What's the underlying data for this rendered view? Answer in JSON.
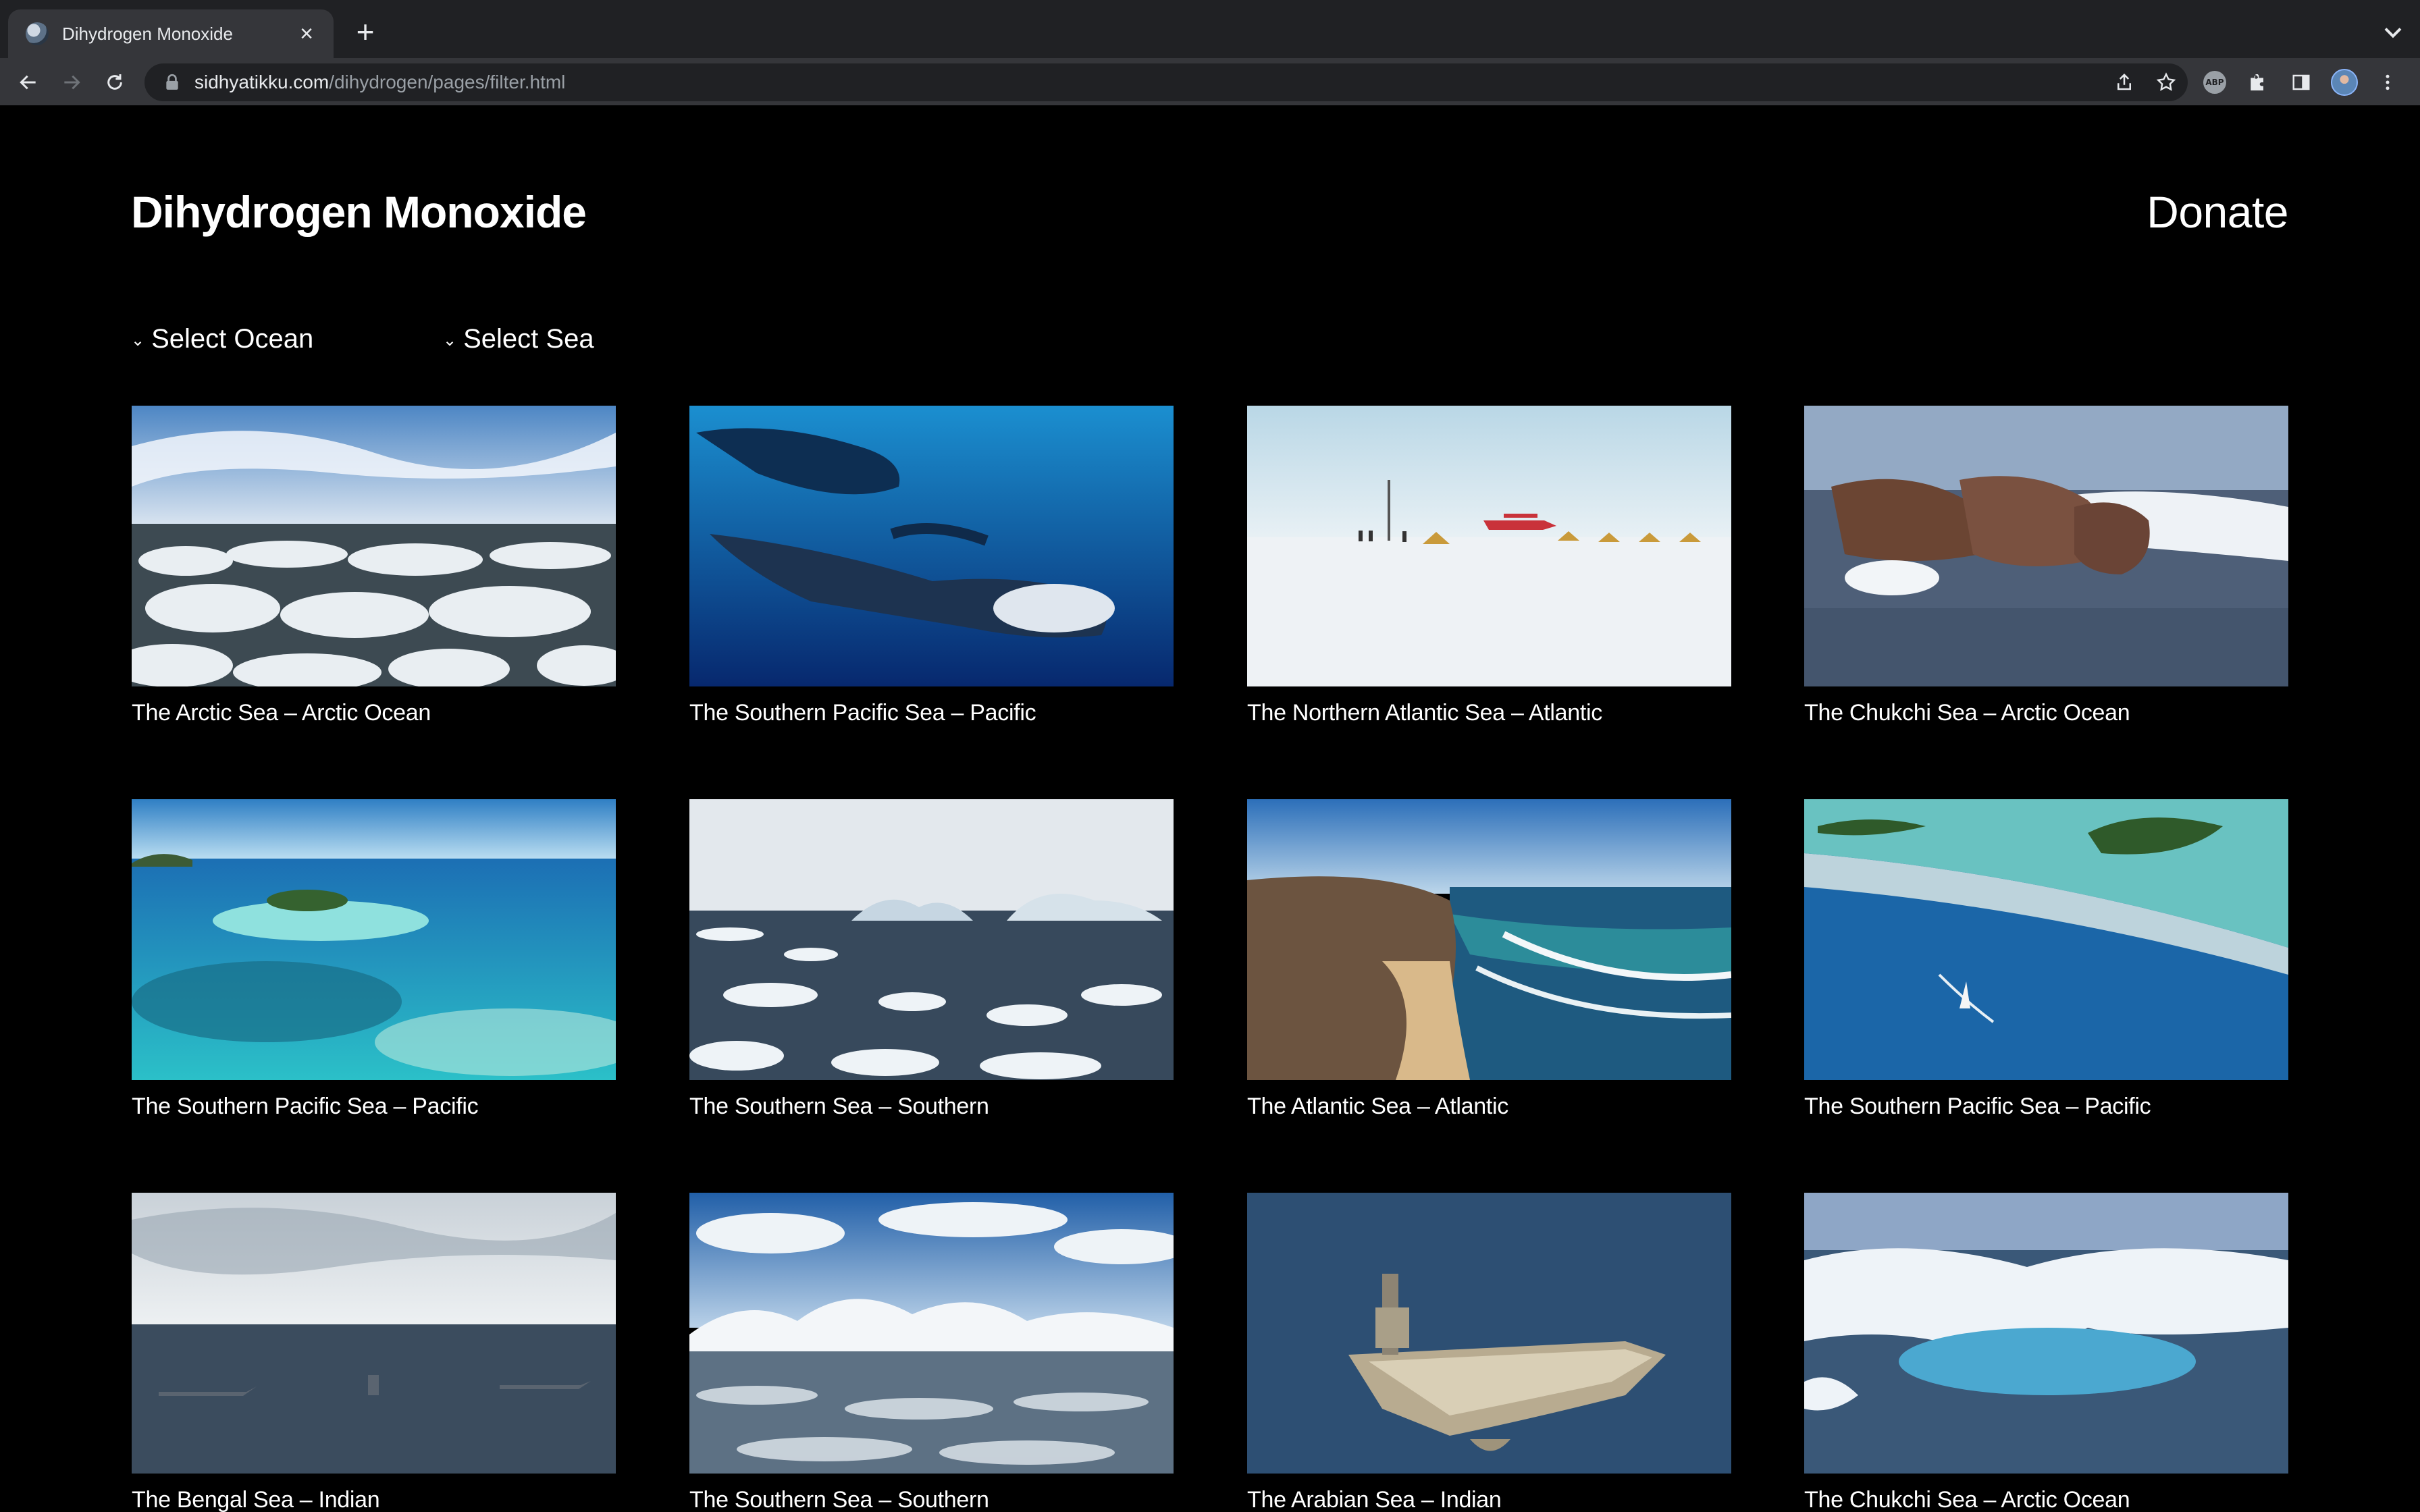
{
  "browser": {
    "tab_title": "Dihydrogen Monoxide",
    "url_host": "sidhyatikku.com",
    "url_path": "/dihydrogen/pages/filter.html",
    "extension_label": "ABP"
  },
  "header": {
    "title": "Dihydrogen Monoxide",
    "donate_label": "Donate"
  },
  "filters": {
    "ocean_label": "Select Ocean",
    "sea_label": "Select Sea"
  },
  "cards": [
    {
      "caption": "The Arctic Sea – Arctic Ocean",
      "scene": "ice-floes"
    },
    {
      "caption": "The Southern Pacific Sea – Pacific",
      "scene": "manta-rays"
    },
    {
      "caption": "The Northern Atlantic Sea – Atlantic",
      "scene": "ice-camp"
    },
    {
      "caption": "The Chukchi Sea – Arctic Ocean",
      "scene": "walruses"
    },
    {
      "caption": "The Southern Pacific Sea – Pacific",
      "scene": "tropical-lagoon"
    },
    {
      "caption": "The Southern Sea – Southern",
      "scene": "icebergs"
    },
    {
      "caption": "The Atlantic Sea – Atlantic",
      "scene": "coastal-cliffs"
    },
    {
      "caption": "The Southern Pacific Sea – Pacific",
      "scene": "reef-sailboat"
    },
    {
      "caption": "The Bengal Sea – Indian",
      "scene": "naval-fleet"
    },
    {
      "caption": "The Southern Sea – Southern",
      "scene": "antarctic-mountains"
    },
    {
      "caption": "The Arabian Sea – Indian",
      "scene": "aircraft-carrier"
    },
    {
      "caption": "The Chukchi Sea – Arctic Ocean",
      "scene": "melting-ice"
    }
  ],
  "colors": {
    "page_background": "#000000",
    "chrome_tabbar": "#202124",
    "chrome_toolbar": "#35363a",
    "text": "#ffffff"
  }
}
